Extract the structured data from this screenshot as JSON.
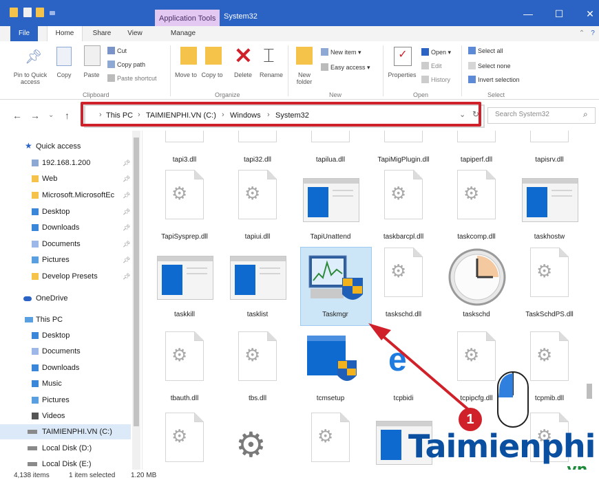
{
  "window": {
    "context_tab": "Application Tools",
    "title": "System32"
  },
  "ribbon_tabs": [
    "File",
    "Home",
    "Share",
    "View",
    "Manage"
  ],
  "ribbon": {
    "clipboard": {
      "pin_to_quick_access": "Pin to Quick access",
      "copy": "Copy",
      "paste": "Paste",
      "cut": "Cut",
      "copy_path": "Copy path",
      "paste_shortcut": "Paste shortcut",
      "group": "Clipboard"
    },
    "organize": {
      "move_to": "Move to",
      "copy_to": "Copy to",
      "delete": "Delete",
      "rename": "Rename",
      "group": "Organize"
    },
    "new": {
      "new_folder": "New folder",
      "new_item": "New item",
      "easy_access": "Easy access",
      "group": "New"
    },
    "open": {
      "properties": "Properties",
      "open": "Open",
      "edit": "Edit",
      "history": "History",
      "group": "Open"
    },
    "select": {
      "select_all": "Select all",
      "select_none": "Select none",
      "invert_selection": "Invert selection",
      "group": "Select"
    }
  },
  "address": {
    "crumbs": [
      "This PC",
      "TAIMIENPHI.VN (C:)",
      "Windows",
      "System32"
    ],
    "search_placeholder": "Search System32"
  },
  "nav": {
    "quick_access": "Quick access",
    "quick_items": [
      {
        "label": "192.168.1.200",
        "icon": "network-folder-icon"
      },
      {
        "label": "Web",
        "icon": "folder-icon"
      },
      {
        "label": "Microsoft.MicrosoftEc",
        "icon": "folder-icon"
      },
      {
        "label": "Desktop",
        "icon": "desktop-icon"
      },
      {
        "label": "Downloads",
        "icon": "downloads-icon"
      },
      {
        "label": "Documents",
        "icon": "documents-icon"
      },
      {
        "label": "Pictures",
        "icon": "pictures-icon"
      },
      {
        "label": "Develop Presets",
        "icon": "folder-icon"
      }
    ],
    "onedrive": "OneDrive",
    "this_pc": "This PC",
    "pc_items": [
      {
        "label": "Desktop",
        "icon": "desktop-icon"
      },
      {
        "label": "Documents",
        "icon": "documents-icon"
      },
      {
        "label": "Downloads",
        "icon": "downloads-icon"
      },
      {
        "label": "Music",
        "icon": "music-icon"
      },
      {
        "label": "Pictures",
        "icon": "pictures-icon"
      },
      {
        "label": "Videos",
        "icon": "videos-icon"
      },
      {
        "label": "TAIMIENPHI.VN (C:)",
        "icon": "drive-icon"
      },
      {
        "label": "Local Disk (D:)",
        "icon": "drive-icon"
      },
      {
        "label": "Local Disk (E:)",
        "icon": "drive-icon"
      }
    ]
  },
  "files": {
    "row0": [
      "tapi3.dll",
      "tapi32.dll",
      "tapilua.dll",
      "TapiMigPlugin.dll",
      "tapiperf.dll",
      "tapisrv.dll"
    ],
    "row1": [
      "TapiSysprep.dll",
      "tapiui.dll",
      "TapiUnattend",
      "taskbarcpl.dll",
      "taskcomp.dll",
      "taskhostw"
    ],
    "row2": [
      "taskkill",
      "tasklist",
      "Taskmgr",
      "taskschd.dll",
      "taskschd",
      "TaskSchdPS.dll"
    ],
    "row3": [
      "tbauth.dll",
      "tbs.dll",
      "tcmsetup",
      "tcpbidi",
      "tcpipcfg.dll",
      "tcpmib.dll"
    ]
  },
  "status": {
    "items": "4,138 items",
    "selected": "1 item selected",
    "size": "1.20 MB"
  },
  "annotation": {
    "step": "1",
    "brand": "Taimienphi",
    "brand_tld": ".vn"
  },
  "colors": {
    "title_bar": "#2b63c5",
    "context_tab": "#e3c9f1",
    "highlight_red": "#d0202a",
    "selection": "#cde6f7",
    "app_blue": "#0f6ad0"
  }
}
